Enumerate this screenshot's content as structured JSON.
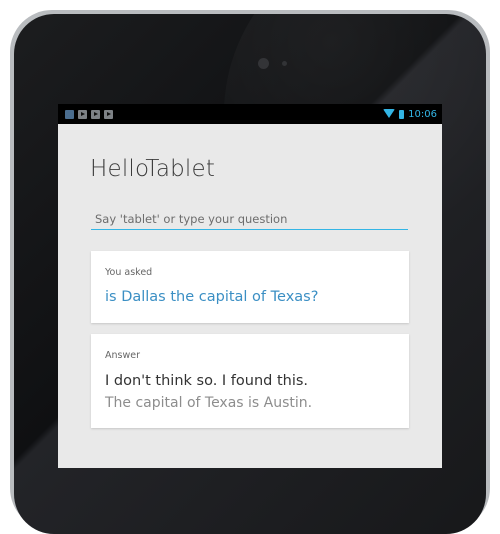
{
  "status_bar": {
    "time": "10:06",
    "notification_icons": [
      "app-icon",
      "play-icon",
      "play-icon",
      "play-icon"
    ],
    "wifi_icon": "wifi-icon",
    "battery_icon": "battery-icon",
    "accent_color": "#33b5e5"
  },
  "app": {
    "title": "HelloTablet",
    "search": {
      "placeholder": "Say 'tablet' or type your question",
      "value": ""
    },
    "asked_card": {
      "label": "You asked",
      "question": "is Dallas the capital of Texas?"
    },
    "answer_card": {
      "label": "Answer",
      "main": "I don't think so. I found this.",
      "detail": "The capital of Texas is Austin."
    },
    "colors": {
      "background": "#e9e9e9",
      "question_text": "#3b8fc4"
    }
  }
}
